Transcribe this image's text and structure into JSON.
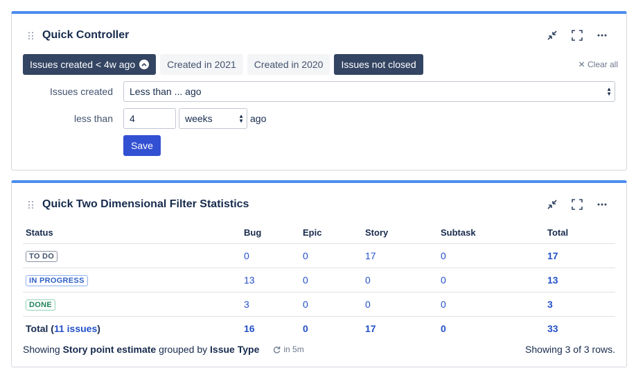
{
  "controller": {
    "title": "Quick Controller",
    "filters": [
      {
        "label": "Issues created < 4w ago",
        "active": true,
        "expanded": true
      },
      {
        "label": "Created in 2021",
        "active": false
      },
      {
        "label": "Created in 2020",
        "active": false
      },
      {
        "label": "Issues not closed",
        "active": true
      }
    ],
    "clear_all": "Clear all",
    "issues_created_label": "Issues created",
    "issues_created_value": "Less than ... ago",
    "less_than_label": "less than",
    "amount_value": "4",
    "unit_value": "weeks",
    "ago_label": "ago",
    "save_label": "Save"
  },
  "stats": {
    "title": "Quick Two Dimensional Filter Statistics",
    "columns": [
      "Status",
      "Bug",
      "Epic",
      "Story",
      "Subtask",
      "Total"
    ],
    "rows": [
      {
        "status": "TO DO",
        "bug": "0",
        "epic": "0",
        "story": "17",
        "subtask": "0",
        "total": "17"
      },
      {
        "status": "IN PROGRESS",
        "bug": "13",
        "epic": "0",
        "story": "0",
        "subtask": "0",
        "total": "13"
      },
      {
        "status": "DONE",
        "bug": "3",
        "epic": "0",
        "story": "0",
        "subtask": "0",
        "total": "3"
      }
    ],
    "total_row": {
      "label": "Total",
      "issues_link": "11 issues",
      "bug": "16",
      "epic": "0",
      "story": "17",
      "subtask": "0",
      "total": "33"
    },
    "footer": {
      "showing": "Showing",
      "field": "Story point estimate",
      "grouped_by": "grouped by",
      "group_field": "Issue Type",
      "refresh": "in 5m",
      "rows_info": "Showing 3 of 3 rows."
    }
  },
  "colors": {
    "accent": "#4c8cf0",
    "dark_chip": "#344563",
    "primary_button": "#3250d2",
    "link": "#2250c8"
  }
}
